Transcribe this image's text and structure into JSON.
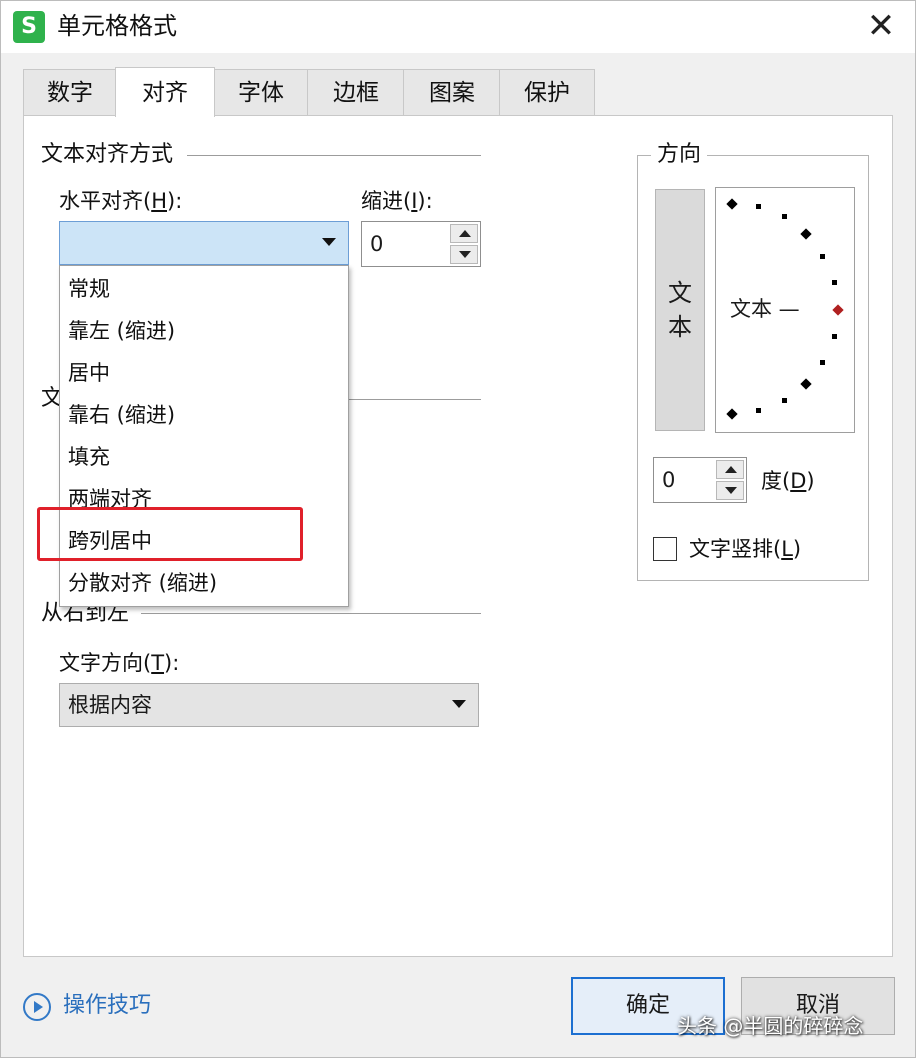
{
  "window": {
    "icon_letter": "S",
    "title": "单元格格式",
    "close_glyph": "✕"
  },
  "tabs": [
    {
      "label": "数字",
      "active": false
    },
    {
      "label": "对齐",
      "active": true
    },
    {
      "label": "字体",
      "active": false
    },
    {
      "label": "边框",
      "active": false
    },
    {
      "label": "图案",
      "active": false
    },
    {
      "label": "保护",
      "active": false
    }
  ],
  "text_alignment": {
    "group_title": "文本对齐方式",
    "horizontal_label_pre": "水平对齐(",
    "horizontal_label_key": "H",
    "horizontal_label_post": "):",
    "horizontal_value": "",
    "indent_label_pre": "缩进(",
    "indent_label_key": "I",
    "indent_label_post": "):",
    "indent_value": "0"
  },
  "horizontal_dropdown": {
    "items": [
      "常规",
      "靠左 (缩进)",
      "居中",
      "靠右 (缩进)",
      "填充",
      "两端对齐",
      "跨列居中",
      "分散对齐 (缩进)"
    ],
    "highlighted": "跨列居中"
  },
  "hidden_group_initial": "文",
  "rtl": {
    "group_title": "从右到左",
    "direction_label_pre": "文字方向(",
    "direction_label_key": "T",
    "direction_label_post": "):",
    "direction_value": "根据内容"
  },
  "orientation": {
    "group_title": "方向",
    "vertical_text": [
      "文",
      "本"
    ],
    "dial_text": "文本 —",
    "degree_value": "0",
    "degree_label_pre": "度(",
    "degree_label_key": "D",
    "degree_label_post": ")",
    "vertical_checkbox_pre": "文字竖排(",
    "vertical_checkbox_key": "L",
    "vertical_checkbox_post": ")",
    "vertical_checked": false
  },
  "footer": {
    "tips_label": "操作技巧",
    "ok_label": "确定",
    "cancel_label": "取消"
  },
  "watermark": "头条 @半圆的碎碎念",
  "colors": {
    "accent_blue": "#1c6fd1",
    "highlight_red": "#e0202a",
    "app_green": "#2fb24c"
  }
}
